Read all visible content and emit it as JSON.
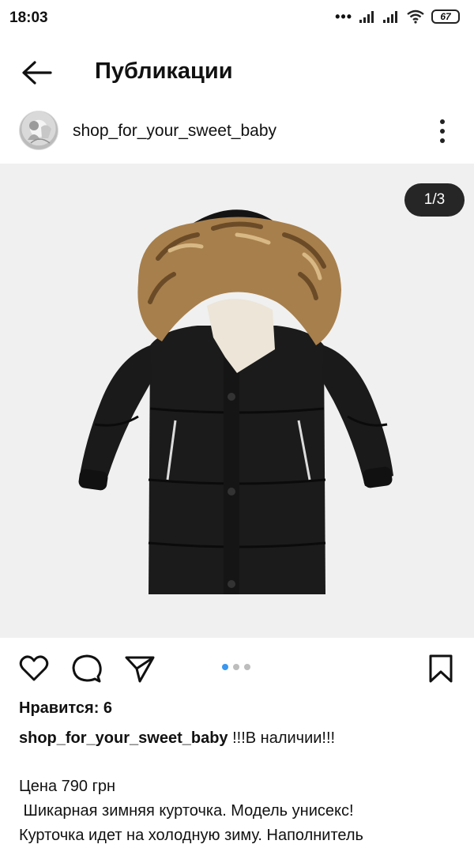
{
  "status_bar": {
    "time": "18:03",
    "battery": "67",
    "icons": [
      "more-dots-icon",
      "signal-icon",
      "signal-icon",
      "wifi-icon",
      "battery-icon"
    ]
  },
  "header": {
    "title": "Публикации",
    "back_icon": "arrow-left-icon"
  },
  "post": {
    "username": "shop_for_your_sweet_baby",
    "menu_icon": "more-vertical-icon",
    "image_counter": "1/3",
    "image_subject": "black winter puffer jacket with fur hood",
    "carousel": {
      "count": 3,
      "active": 1
    },
    "actions": [
      "heart-icon",
      "comment-icon",
      "send-icon",
      "bookmark-icon"
    ],
    "likes": "Нравится: 6",
    "caption_user": "shop_for_your_sweet_baby",
    "caption_text": " !!!В наличии!!!",
    "lines": [
      "",
      "Цена 790 грн",
      " Шикарная зимняя курточка. Модель унисекс!",
      "Курточка идет на холодную зиму. Наполнитель"
    ]
  },
  "colors": {
    "accent": "#3897f0",
    "counter_bg": "#262626",
    "photo_bg": "#f0f0f0"
  }
}
